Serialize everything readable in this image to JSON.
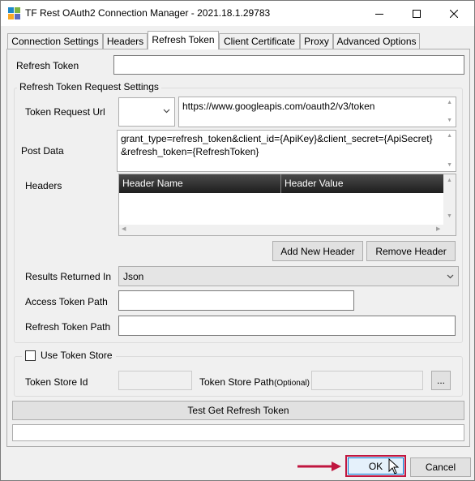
{
  "window": {
    "title": "TF Rest OAuth2 Connection Manager - 2021.18.1.29783",
    "minimize_icon": "minimize-icon",
    "maximize_icon": "maximize-icon",
    "close_icon": "close-icon"
  },
  "tabs": [
    {
      "label": "Connection Settings"
    },
    {
      "label": "Headers"
    },
    {
      "label": "Refresh Token"
    },
    {
      "label": "Client Certificate"
    },
    {
      "label": "Proxy"
    },
    {
      "label": "Advanced Options"
    }
  ],
  "active_tab": "Refresh Token",
  "refresh_token": {
    "label": "Refresh Token",
    "value": ""
  },
  "request_settings": {
    "group_title": "Refresh Token Request Settings",
    "token_request_url": {
      "label": "Token Request Url",
      "method_value": "",
      "url_value": "https://www.googleapis.com/oauth2/v3/token"
    },
    "post_data": {
      "label": "Post Data",
      "line1": "grant_type=refresh_token&client_id={ApiKey}&client_secret={ApiSecret}",
      "line2": "&refresh_token={RefreshToken}"
    },
    "headers": {
      "label": "Headers",
      "columns": [
        "Header Name",
        "Header Value"
      ]
    },
    "add_header_label": "Add New Header",
    "remove_header_label": "Remove Header",
    "results_returned_in": {
      "label": "Results Returned In",
      "value": "Json"
    },
    "access_token_path": {
      "label": "Access Token Path",
      "value": ""
    },
    "refresh_token_path": {
      "label": "Refresh Token Path",
      "value": ""
    }
  },
  "token_store": {
    "checkbox_label": "Use Token Store",
    "checked": false,
    "store_id_label": "Token Store Id",
    "store_id_value": "",
    "store_path_label": "Token Store Path",
    "store_path_suffix": "(Optional)",
    "store_path_value": "",
    "browse_label": "..."
  },
  "test_button_label": "Test Get Refresh Token",
  "status_value": "",
  "footer": {
    "ok_label": "OK",
    "cancel_label": "Cancel",
    "accent_color": "#c0163f",
    "arrow_color": "#c0163f"
  }
}
